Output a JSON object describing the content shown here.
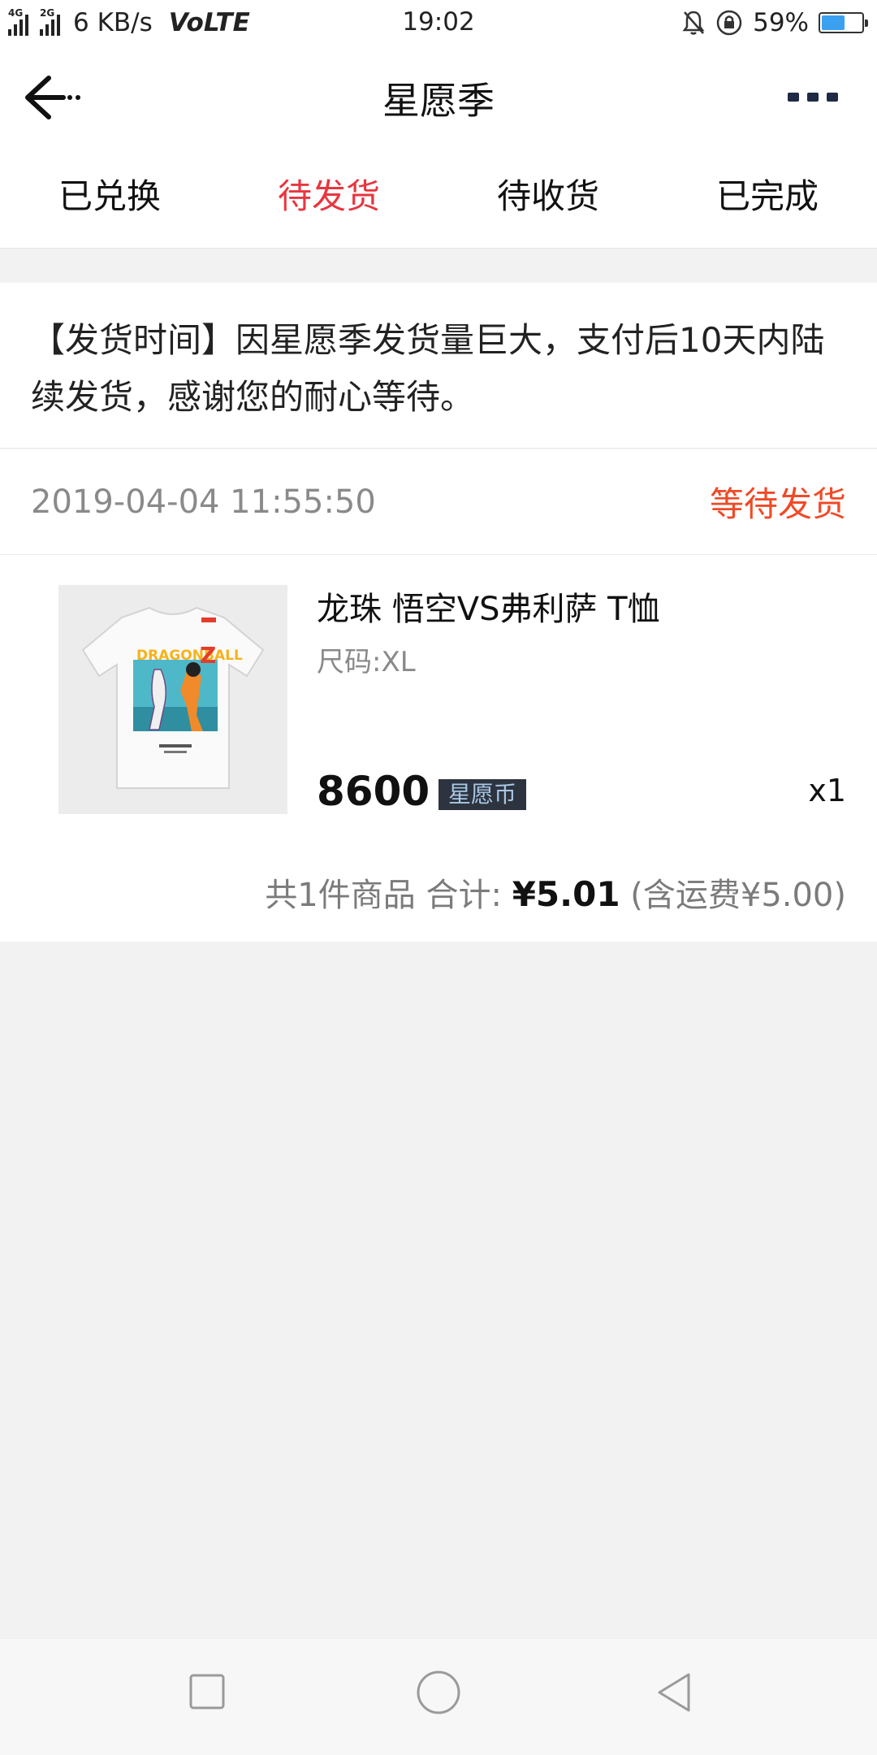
{
  "status_bar": {
    "network": "4G 2G",
    "speed": "6 KB/s",
    "volte": "VoLTE",
    "time": "19:02",
    "battery": "59%",
    "battery_level": 0.59,
    "icons": [
      "mute-bell-icon",
      "rotation-lock-icon",
      "battery-icon"
    ]
  },
  "nav": {
    "title": "星愿季",
    "back_icon": "back-arrow-icon",
    "more_icon": "more-icon"
  },
  "tabs": [
    {
      "label": "已兑换",
      "active": false
    },
    {
      "label": "待发货",
      "active": true
    },
    {
      "label": "待收货",
      "active": false
    },
    {
      "label": "已完成",
      "active": false
    }
  ],
  "notice": {
    "text": "【发货时间】因星愿季发货量巨大，支付后10天内陆续发货，感谢您的耐心等待。"
  },
  "order": {
    "datetime": "2019-04-04 11:55:50",
    "status": "等待发货",
    "product": {
      "name": "龙珠 悟空VS弗利萨 T恤",
      "size": "尺码:XL",
      "price": "8600",
      "currency": "星愿币",
      "quantity": "x1",
      "image": "tshirt-image"
    },
    "summary": {
      "count_text": "共1件商品",
      "total_label": "合计:",
      "total": "¥5.01",
      "shipping": "(含运费¥5.00)"
    }
  },
  "system_nav": [
    "recent-apps-icon",
    "home-icon",
    "back-triangle-icon"
  ],
  "colors": {
    "accent": "#e8363f",
    "status_orange": "#f04a27",
    "page_bg": "#f2f2f2",
    "currency_tag_bg": "#2d3440"
  }
}
